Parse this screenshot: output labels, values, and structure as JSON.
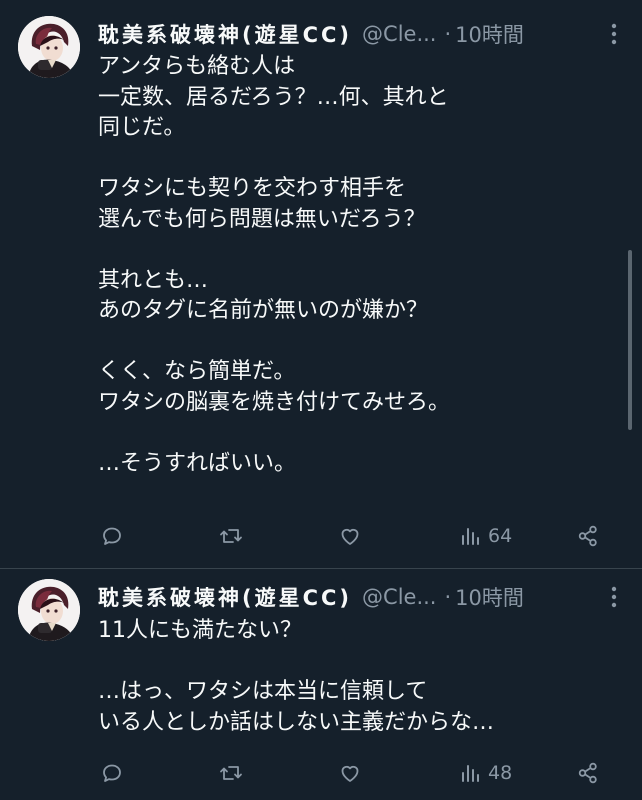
{
  "tweets": [
    {
      "author_name": "耽美系破壊神(遊星CC)",
      "handle": "@Cle...",
      "dot": "·",
      "time": "10時間",
      "text": "アンタらも絡む人は\n一定数、居るだろう？…何、其れと\n同じだ。\n\nワタシにも契りを交わす相手を\n選んでも何ら問題は無いだろう？\n\n其れとも…\nあのタグに名前が無いのが嫌か？\n\nくく、なら簡単だ。\nワタシの脳裏を焼き付けてみせろ。\n\n…そうすればいい。",
      "views": "64",
      "icons": [
        "avatar",
        "more-icon",
        "reply-icon",
        "retweet-icon",
        "like-icon",
        "views-icon",
        "share-icon"
      ]
    },
    {
      "author_name": "耽美系破壊神(遊星CC)",
      "handle": "@Cle...",
      "dot": "·",
      "time": "10時間",
      "text": "11人にも満たない？\n\n…はっ、ワタシは本当に信頼して\nいる人としか話はしない主義だからな…",
      "views": "48",
      "icons": [
        "avatar",
        "more-icon",
        "reply-icon",
        "retweet-icon",
        "like-icon",
        "views-icon",
        "share-icon"
      ]
    }
  ],
  "colors": {
    "background": "#15202b",
    "text_primary": "#f7f9f9",
    "text_secondary": "#8b98a5",
    "divider": "#38444d"
  }
}
